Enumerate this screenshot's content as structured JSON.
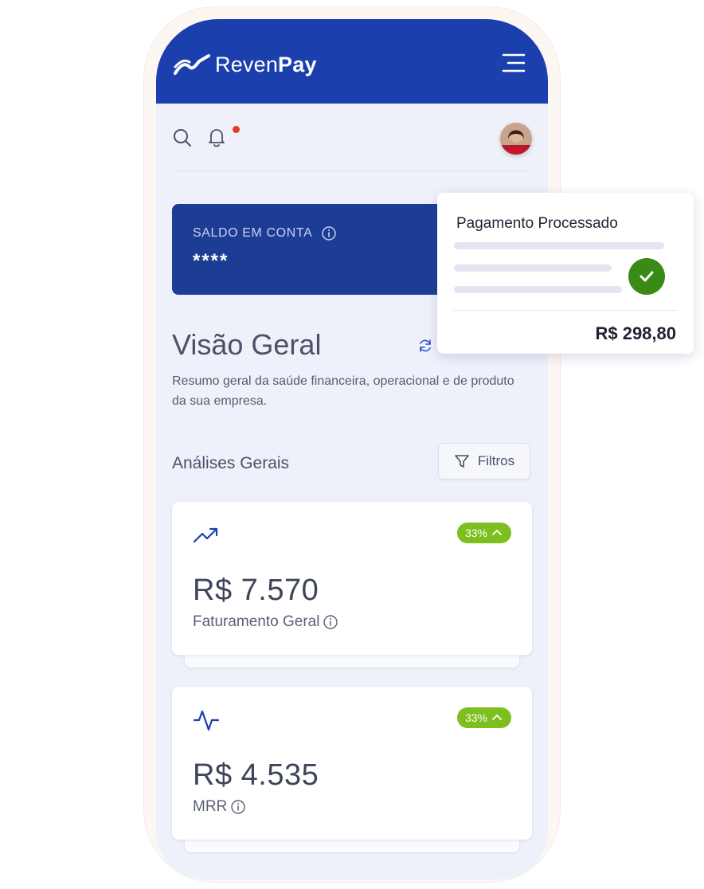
{
  "app": {
    "brand_regular": "Reven",
    "brand_bold": "Pay"
  },
  "balance": {
    "label": "SALDO EM CONTA",
    "value": "****"
  },
  "overview": {
    "title": "Visão Geral",
    "description": "Resumo geral da saúde financeira, operacional e de produto da sua empresa."
  },
  "analytics": {
    "title": "Análises Gerais",
    "filter_label": "Filtros",
    "cards": [
      {
        "icon": "trending-up-icon",
        "badge": "33%",
        "value": "R$ 7.570",
        "label": "Faturamento Geral"
      },
      {
        "icon": "activity-icon",
        "badge": "33%",
        "value": "R$ 4.535",
        "label": "MRR"
      }
    ]
  },
  "payment_popup": {
    "title": "Pagamento Processado",
    "amount": "R$ 298,80"
  },
  "colors": {
    "primary": "#1c3fae",
    "balance_card": "#1d3d94",
    "badge": "#7cbf1e",
    "success": "#3a8a16",
    "notification": "#e53b24"
  }
}
